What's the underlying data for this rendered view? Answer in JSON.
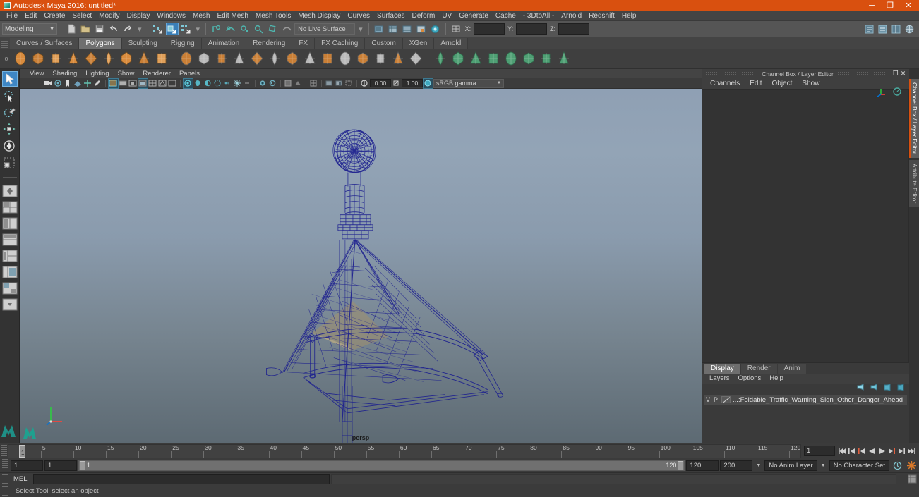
{
  "window": {
    "title": "Autodesk Maya 2016: untitled*",
    "minimize": "─",
    "maximize": "❐",
    "close": "✕"
  },
  "menubar": {
    "items": [
      "File",
      "Edit",
      "Create",
      "Select",
      "Modify",
      "Display",
      "Windows",
      "Mesh",
      "Edit Mesh",
      "Mesh Tools",
      "Mesh Display",
      "Curves",
      "Surfaces",
      "Deform",
      "UV",
      "Generate",
      "Cache",
      "- 3DtoAll -",
      "Arnold",
      "Redshift",
      "Help"
    ]
  },
  "statusline": {
    "mode": "Modeling",
    "live_surface": "No Live Surface",
    "x_label": "X:",
    "y_label": "Y:",
    "z_label": "Z:",
    "x_value": "",
    "y_value": "",
    "z_value": "",
    "icons": [
      "new-scene-icon",
      "open-scene-icon",
      "save-scene-icon",
      "undo-icon",
      "redo-icon",
      "select-by-hierarchy-icon",
      "select-by-object-icon",
      "select-by-component-icon",
      "snap-to-grid-icon",
      "snap-to-curve-icon",
      "snap-to-point-icon",
      "snap-to-projected-center-icon",
      "snap-to-view-plane-icon",
      "make-live-icon"
    ]
  },
  "shelf": {
    "tabs": [
      "Curves / Surfaces",
      "Polygons",
      "Sculpting",
      "Rigging",
      "Animation",
      "Rendering",
      "FX",
      "FX Caching",
      "Custom",
      "XGen",
      "Arnold"
    ],
    "active_tab": "Polygons",
    "buttons": [
      "polygon-sphere-icon",
      "polygon-cube-icon",
      "polygon-cylinder-icon",
      "polygon-cone-icon",
      "polygon-plane-icon",
      "polygon-torus-icon",
      "polygon-prism-icon",
      "polygon-pyramid-icon",
      "polygon-pipe-icon",
      "combine-icon",
      "separate-icon",
      "mirror-geometry-icon",
      "smooth-icon",
      "reduce-icon",
      "quadrangulate-icon",
      "extrude-icon",
      "bevel-icon",
      "bridge-icon",
      "append-polygon-icon",
      "insert-edge-loop-icon",
      "offset-edge-loop-icon",
      "multi-cut-icon",
      "target-weld-icon",
      "uv-editor-icon",
      "uv-planar-icon",
      "uv-cylindrical-icon",
      "uv-spherical-icon",
      "uv-automatic-icon",
      "uv-unfold-icon",
      "uv-layout-icon",
      "uv-snapshot-icon"
    ]
  },
  "toolbox": {
    "tools": [
      {
        "name": "select-tool",
        "active": true
      },
      {
        "name": "lasso-select-tool",
        "active": false
      },
      {
        "name": "paint-select-tool",
        "active": false
      },
      {
        "name": "move-tool",
        "active": false
      },
      {
        "name": "rotate-tool",
        "active": false
      },
      {
        "name": "scale-tool",
        "active": false
      }
    ],
    "layouts": [
      "single-perspective-layout",
      "four-view-layout",
      "two-pane-side-layout",
      "two-pane-stacked-layout",
      "three-pane-layout",
      "outliner-persp-layout",
      "hypershade-persp-layout",
      "more-layouts-icon"
    ]
  },
  "viewport": {
    "panel_menu": [
      "View",
      "Shading",
      "Lighting",
      "Show",
      "Renderer",
      "Panels"
    ],
    "camera_label": "persp",
    "exposure_value": "0.00",
    "gamma_value": "1.00",
    "color_management": "sRGB gamma",
    "toolbar_icons": [
      "camera-attributes-icon",
      "keyframe-camera-icon",
      "bookmark-icon",
      "image-plane-icon",
      "two-d-pan-zoom-icon",
      "grease-pencil-icon",
      "resolution-gate-icon",
      "film-gate-icon",
      "gate-mask-icon",
      "shaded-display-icon",
      "wireframe-on-shaded-icon",
      "xray-icon",
      "xray-joints-icon",
      "lights-default-icon",
      "lights-all-icon",
      "shadows-icon",
      "ambient-occlusion-icon",
      "motion-blur-icon",
      "anti-alias-icon",
      "multisample-icon",
      "depth-of-field-icon",
      "isolate-select-icon",
      "display-textures-icon"
    ],
    "model": {
      "name": "Foldable_Traffic_Warning_Sign_Other_Danger_Ahead",
      "display": "wireframe",
      "wire_color": "#1c1f8f",
      "bg_top": "#8fa0b4",
      "bg_bottom": "#5d6a73"
    }
  },
  "channelbox": {
    "panel_title": "Channel Box / Layer Editor",
    "menu": [
      "Channels",
      "Edit",
      "Object",
      "Show"
    ],
    "float_icon": "❐",
    "close_icon": "✕",
    "body_text": ""
  },
  "layereditor": {
    "tabs": [
      "Display",
      "Render",
      "Anim"
    ],
    "active_tab": "Display",
    "menu": [
      "Layers",
      "Options",
      "Help"
    ],
    "toolbar_icons": [
      "move-layer-up-icon",
      "move-layer-down-icon",
      "new-layer-icon",
      "new-layer-from-selected-icon"
    ],
    "columns": "V  P",
    "layers": [
      {
        "visibility": "V",
        "playback": "P",
        "name": "...:Foldable_Traffic_Warning_Sign_Other_Danger_Ahead"
      }
    ]
  },
  "dock_tabs": {
    "items": [
      "Channel Box / Layer Editor",
      "Attribute Editor"
    ],
    "active": "Channel Box / Layer Editor"
  },
  "timeslider": {
    "ticks": [
      "5",
      "10",
      "15",
      "20",
      "25",
      "30",
      "35",
      "40",
      "45",
      "50",
      "55",
      "60",
      "65",
      "70",
      "75",
      "80",
      "85",
      "90",
      "95",
      "100",
      "105",
      "110",
      "115",
      "120"
    ],
    "range_start": 1,
    "range_end": 120,
    "current_frame": "1",
    "current_frame_field": "1",
    "playback_buttons": [
      "go-to-start-icon",
      "step-back-frame-icon",
      "step-back-key-icon",
      "play-backwards-icon",
      "play-forwards-icon",
      "step-forward-key-icon",
      "step-forward-frame-icon",
      "go-to-end-icon"
    ]
  },
  "rangeslider": {
    "anim_start": "1",
    "range_start": "1",
    "bar_start": "1",
    "bar_end": "120",
    "range_end": "120",
    "anim_end": "200",
    "anim_layer": "No Anim Layer",
    "character_set": "No Character Set",
    "auto_key_icon": "auto-keyframe-icon",
    "anim_prefs_icon": "animation-preferences-icon"
  },
  "commandline": {
    "language": "MEL",
    "input_value": "",
    "output_value": "",
    "script_editor_icon": "script-editor-icon"
  },
  "helpline": {
    "text": "Select Tool: select an object"
  }
}
